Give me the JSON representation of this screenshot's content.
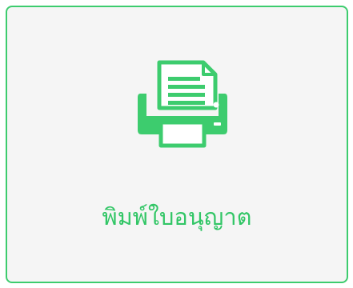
{
  "card": {
    "icon": "printer-icon",
    "label": "พิมพ์ใบอนุญาต",
    "accent_color": "#3dcc6e"
  }
}
